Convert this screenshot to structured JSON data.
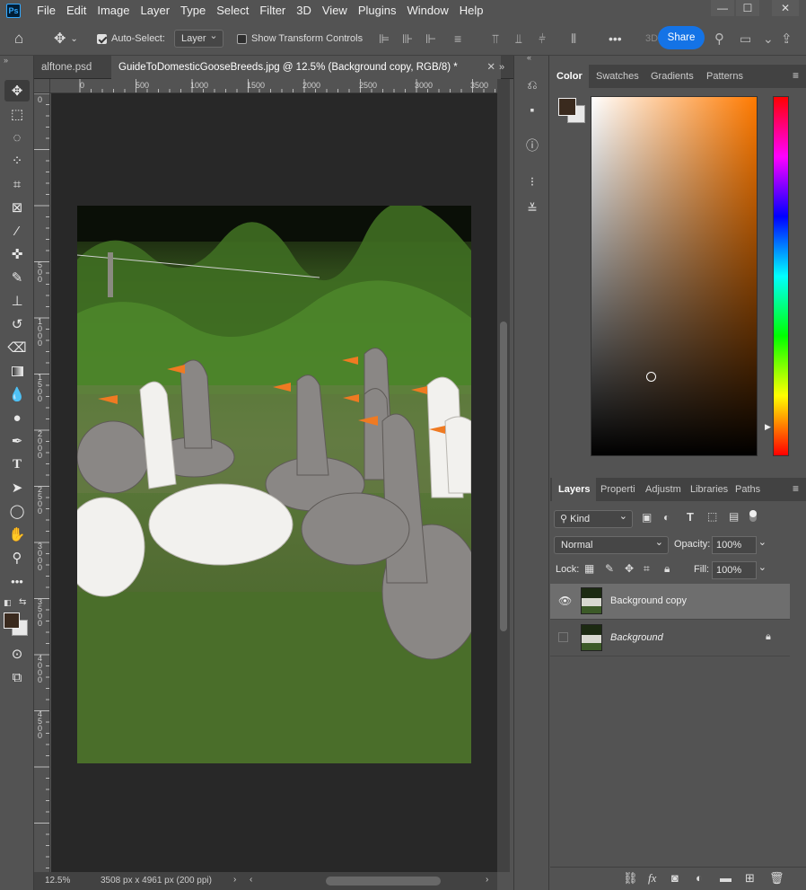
{
  "app": {
    "logo": "Ps"
  },
  "menu": [
    "File",
    "Edit",
    "Image",
    "Layer",
    "Type",
    "Select",
    "Filter",
    "3D",
    "View",
    "Plugins",
    "Window",
    "Help"
  ],
  "window_controls": {
    "minimize": "—",
    "maximize": "☐",
    "close": "✕"
  },
  "options": {
    "auto_select_label": "Auto-Select:",
    "auto_select_checked": true,
    "auto_select_value": "Layer",
    "transform_label": "Show Transform Controls",
    "transform_checked": false,
    "more": "•••",
    "threed": "3D",
    "share": "Share"
  },
  "doc_tabs": [
    {
      "label": "alftone.psd",
      "active": false
    },
    {
      "label": "GuideToDomesticGooseBreeds.jpg @ 12.5% (Background copy, RGB/8) *",
      "active": true
    }
  ],
  "ruler": {
    "h": [
      "0",
      "500",
      "1000",
      "1500",
      "2000",
      "2500",
      "3000",
      "3500"
    ],
    "v": [
      "0",
      "5\n0\n0",
      "1\n0\n0\n0",
      "1\n5\n0\n0",
      "2\n0\n0\n0",
      "2\n5\n0\n0",
      "3\n0\n0\n0",
      "3\n5\n0\n0",
      "4\n0\n0\n0",
      "4\n5\n0\n0"
    ]
  },
  "status": {
    "zoom": "12.5%",
    "info": "3508 px x 4961 px (200 ppi)",
    "arrow": "›"
  },
  "color_panel": {
    "tabs": [
      "Color",
      "Swatches",
      "Gradients",
      "Patterns"
    ],
    "active_tab": "Color",
    "foreground": "#3a2a1e",
    "background": "#e8e8e8",
    "hue_color": "#ff7a00"
  },
  "layers_panel": {
    "tabs": [
      "Layers",
      "Properties",
      "Adjustments",
      "Libraries",
      "Paths"
    ],
    "tab_labels": [
      "Layers",
      "Properti",
      "Adjustm",
      "Libraries",
      "Paths"
    ],
    "active_tab": "Layers",
    "filter": "Kind",
    "blend_mode": "Normal",
    "opacity_label": "Opacity:",
    "opacity": "100%",
    "lock_label": "Lock:",
    "fill_label": "Fill:",
    "fill": "100%",
    "layers": [
      {
        "name": "Background copy",
        "visible": true,
        "selected": true,
        "locked": false
      },
      {
        "name": "Background",
        "visible": false,
        "selected": false,
        "locked": true
      }
    ]
  }
}
